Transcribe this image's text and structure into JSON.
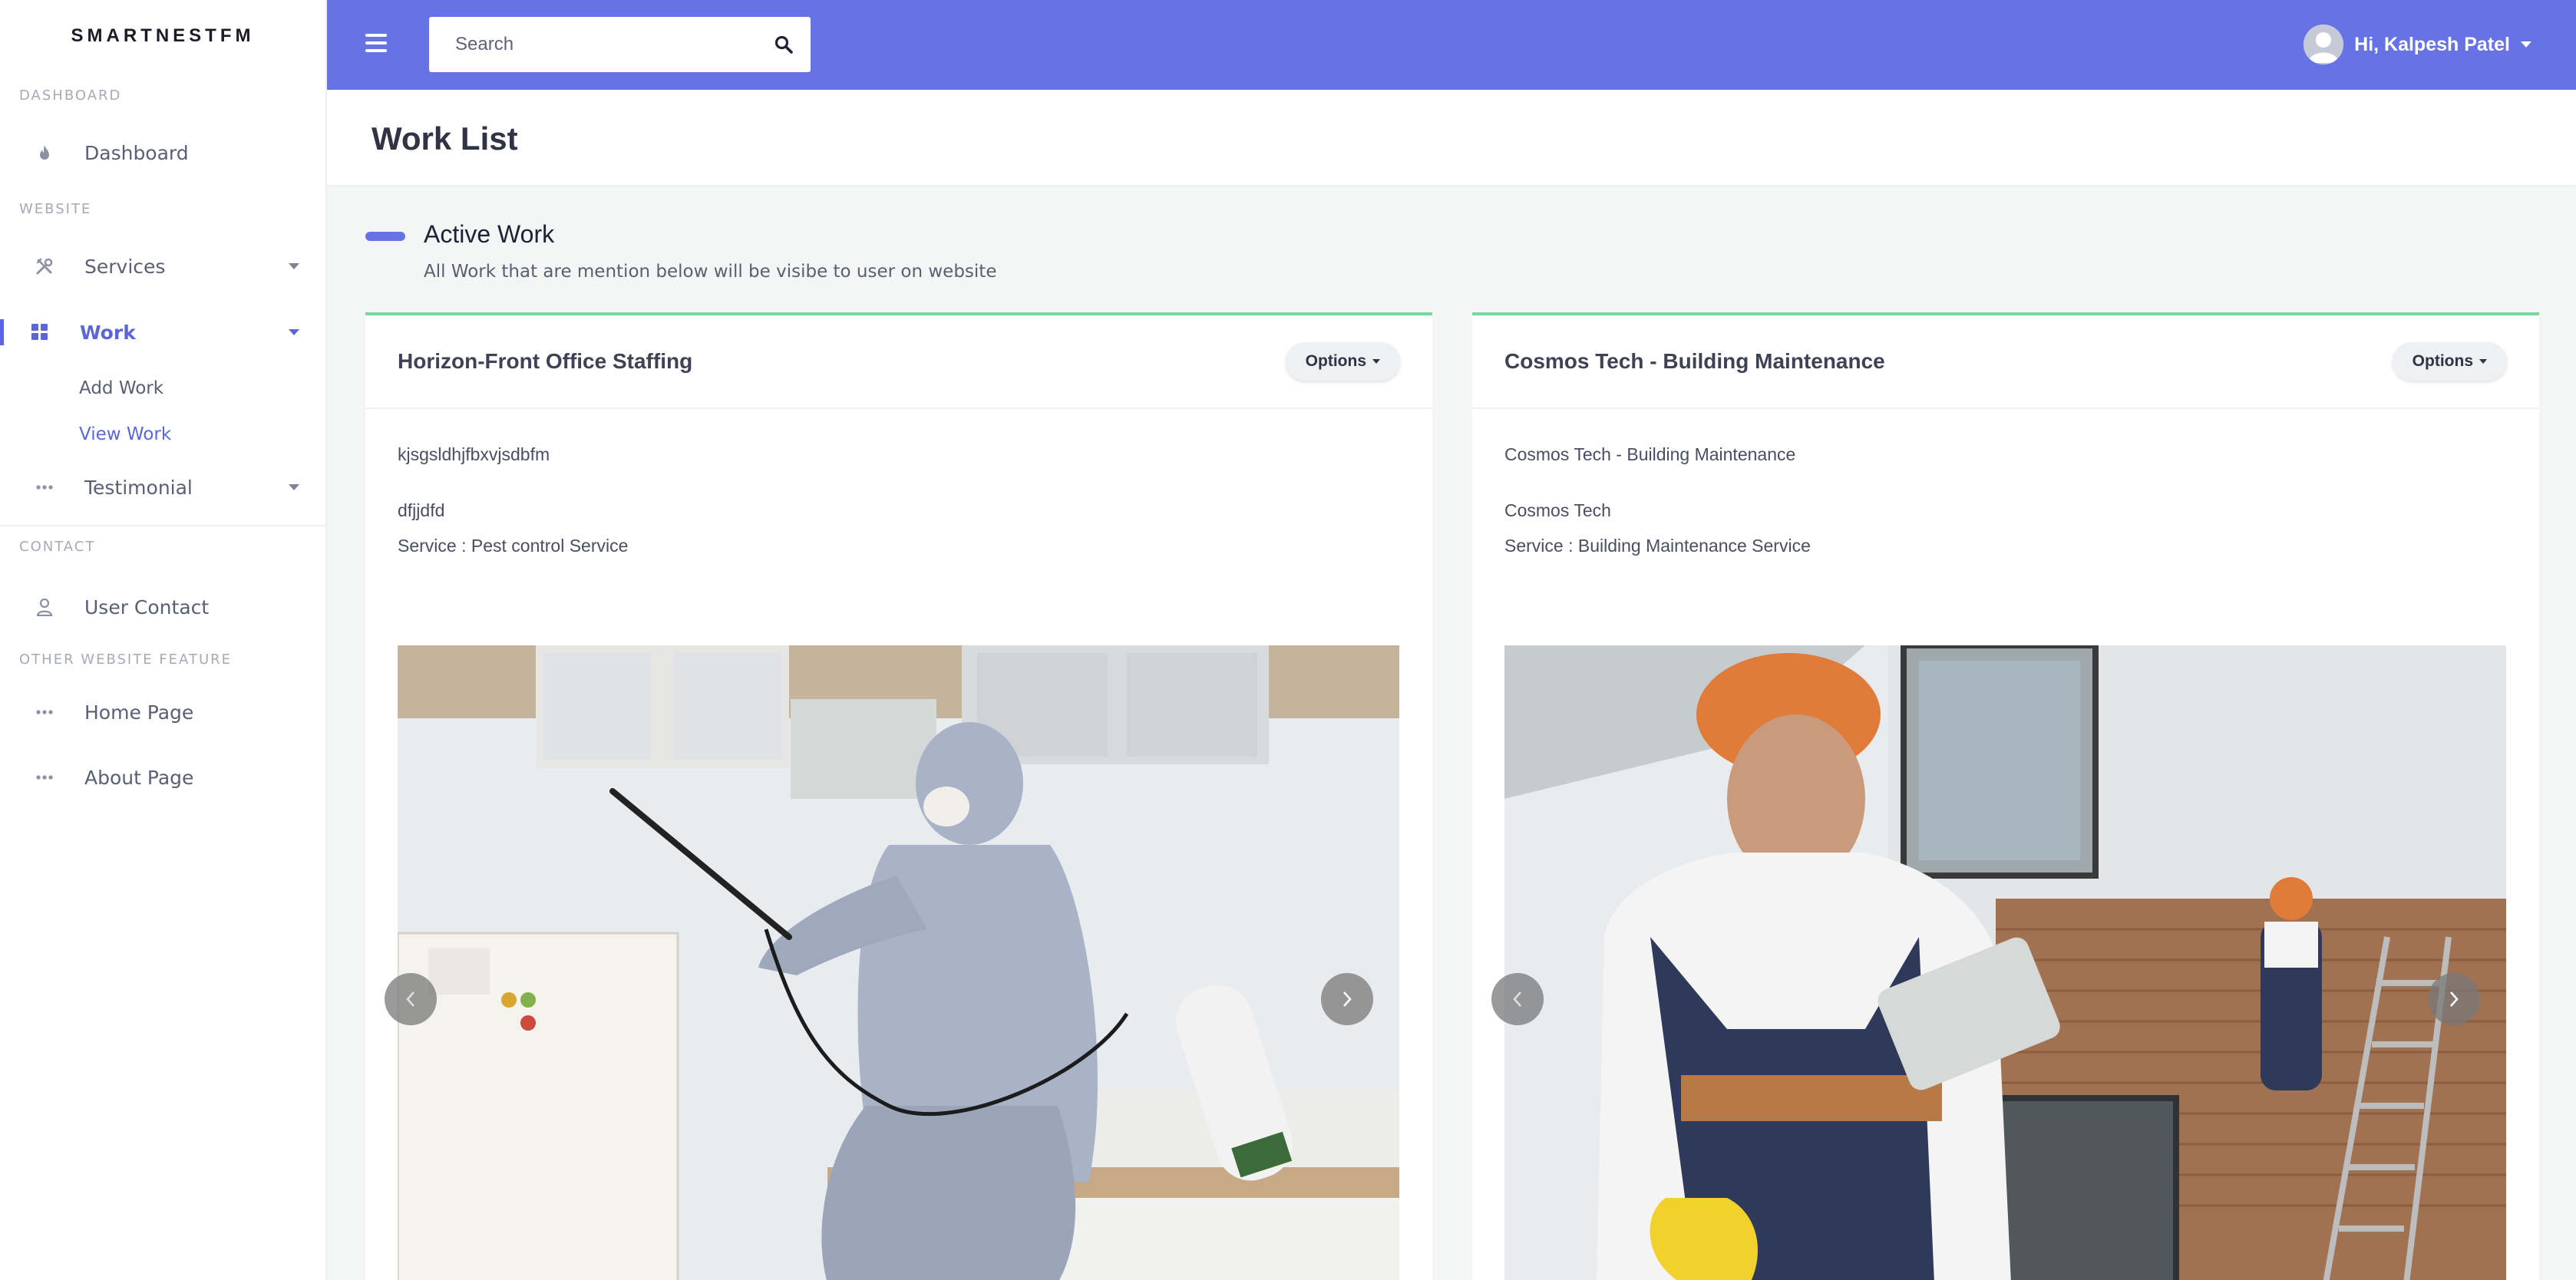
{
  "brand": "SMARTNESTFM",
  "sidebar": {
    "sections": [
      {
        "heading": "DASHBOARD"
      },
      {
        "heading": "WEBSITE"
      },
      {
        "heading": "CONTACT"
      },
      {
        "heading": "OTHER WEBSITE FEATURE"
      }
    ],
    "items": {
      "dashboard": "Dashboard",
      "services": "Services",
      "work": "Work",
      "add_work": "Add Work",
      "view_work": "View Work",
      "testimonial": "Testimonial",
      "user_contact": "User Contact",
      "home_page": "Home Page",
      "about_page": "About Page"
    }
  },
  "topbar": {
    "search_placeholder": "Search",
    "user_greeting": "Hi, Kalpesh Patel",
    "accent_color": "#6773e4"
  },
  "page": {
    "title": "Work List",
    "section_title": "Active Work",
    "section_subtitle": "All Work that are mention below will be visibe to user on website"
  },
  "cards": [
    {
      "title": "Horizon-Front Office Staffing",
      "options_label": "Options",
      "line1": "kjsgsldhjfbxvjsdbfm",
      "line2": "dfjjdfd",
      "service": "Service : Pest control Service"
    },
    {
      "title": "Cosmos Tech - Building Maintenance",
      "options_label": "Options",
      "line1": "Cosmos Tech - Building Maintenance",
      "line2": "Cosmos Tech",
      "service": "Service : Building Maintenance Service"
    }
  ],
  "icons": [
    "fire-icon",
    "tools-icon",
    "grid-icon",
    "dots-icon",
    "user-icon",
    "search-icon",
    "menu-icon",
    "chevron-left-icon",
    "chevron-right-icon"
  ]
}
